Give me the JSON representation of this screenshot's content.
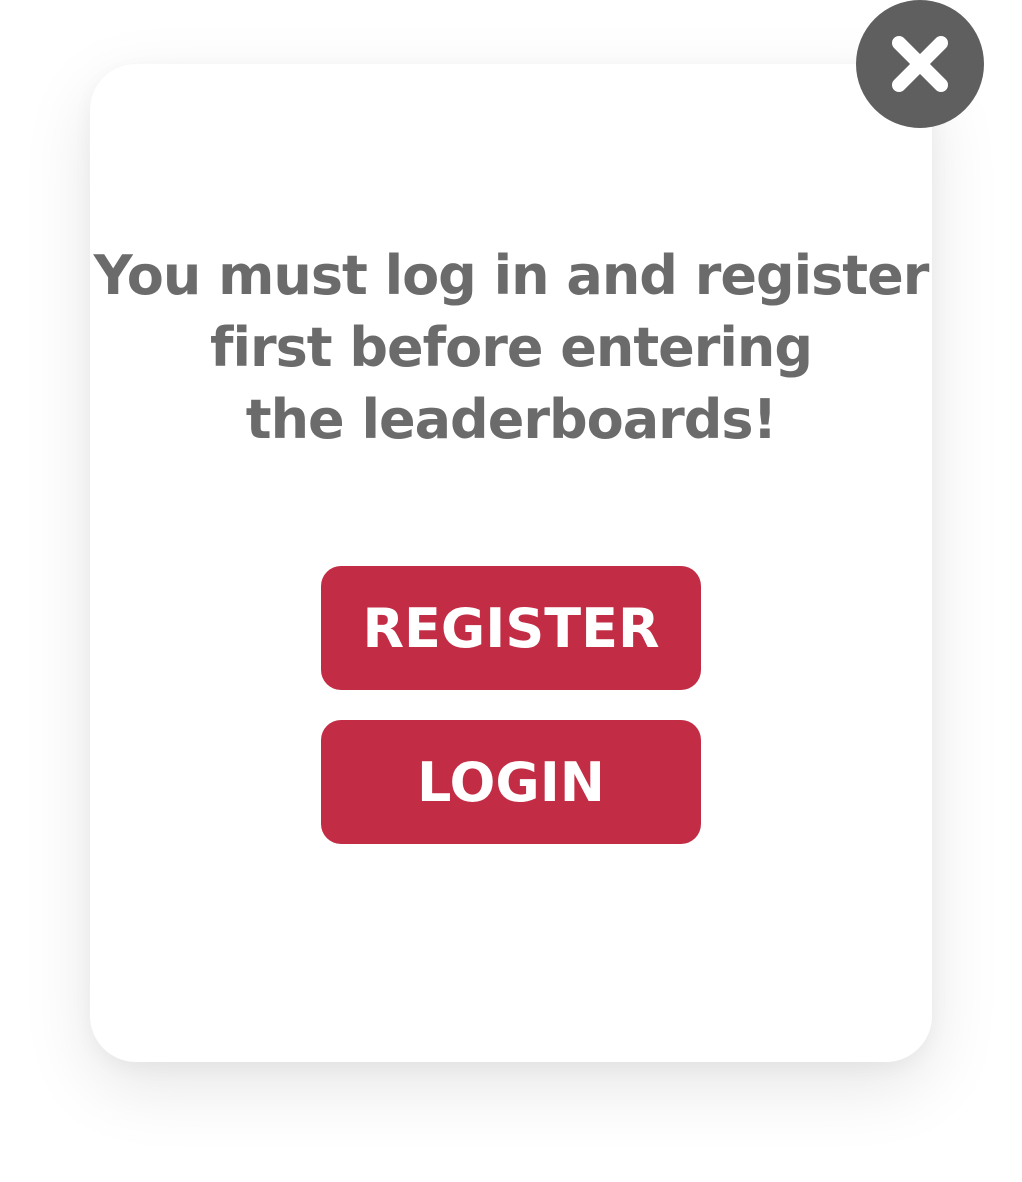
{
  "dialog": {
    "message": "You must log in and register\nfirst before entering\nthe leaderboards!",
    "register_label": "REGISTER",
    "login_label": "LOGIN",
    "close_icon": "close-icon"
  },
  "colors": {
    "accent": "#c22d45",
    "text": "#6b6b6b",
    "close_bg": "#5f5f5f",
    "background": "#ffffff"
  }
}
